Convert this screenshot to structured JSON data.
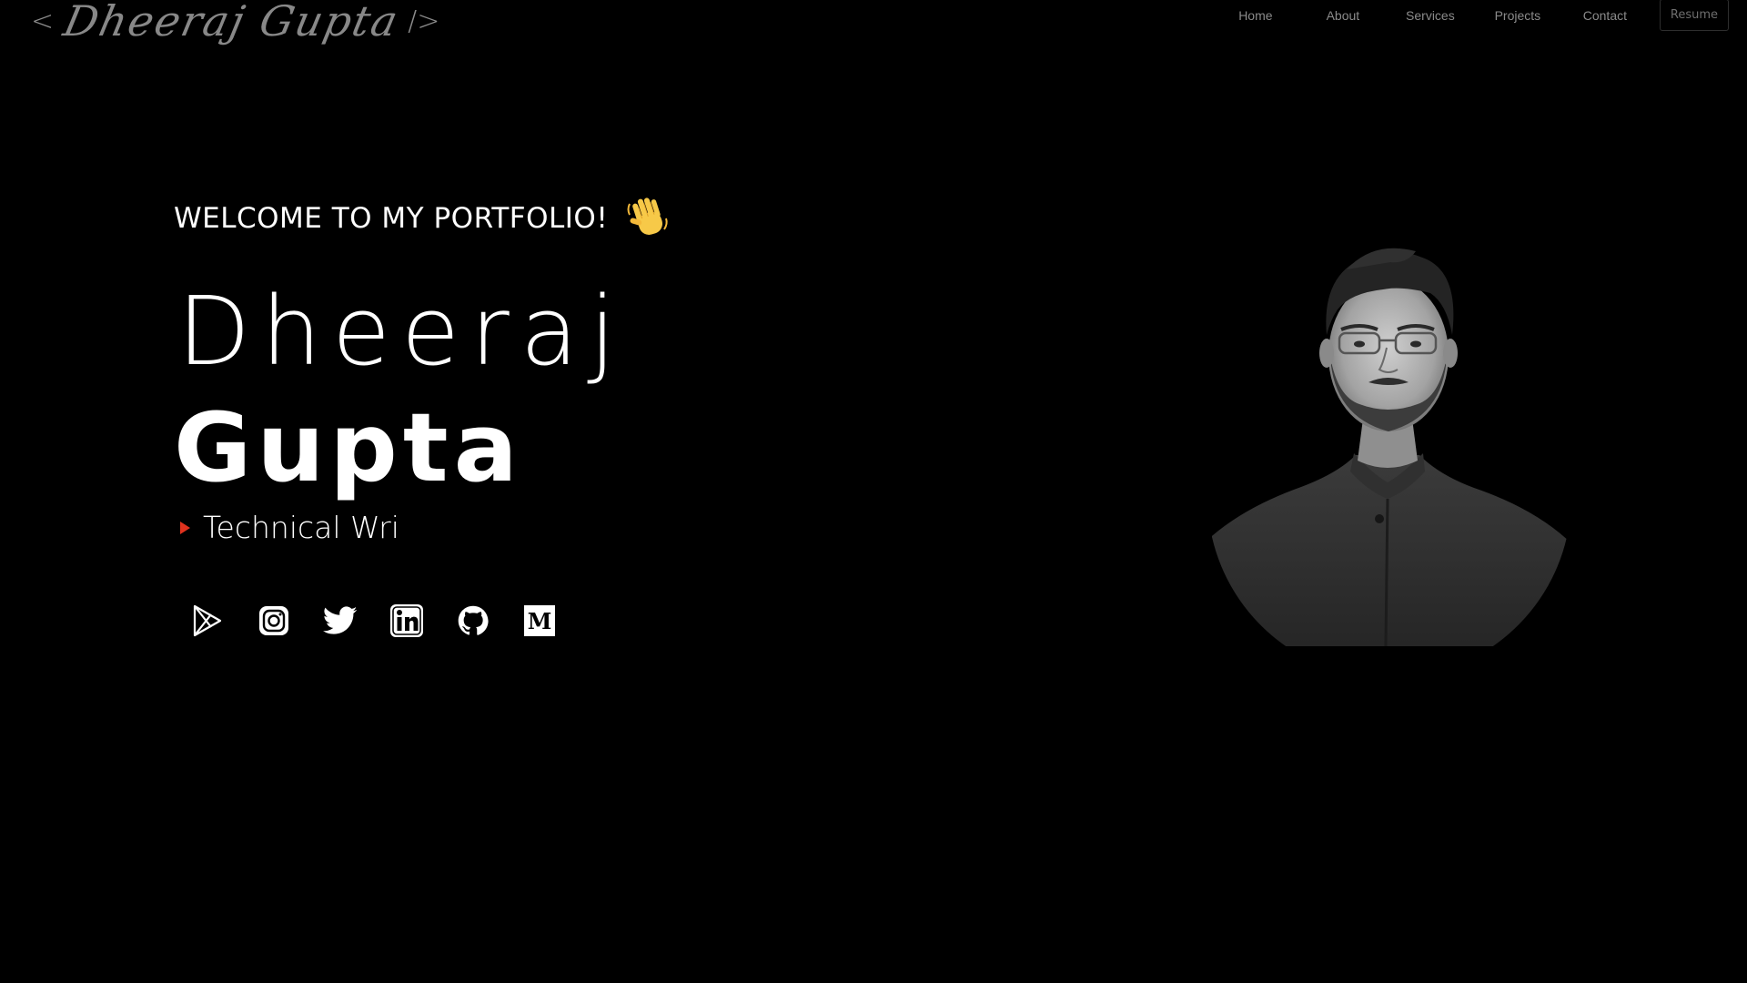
{
  "header": {
    "logo": {
      "open_bracket": "<",
      "signature": "Dheeraj Gupta",
      "close_bracket": "/>"
    },
    "nav": [
      {
        "label": "Home"
      },
      {
        "label": "About"
      },
      {
        "label": "Services"
      },
      {
        "label": "Projects"
      },
      {
        "label": "Contact"
      }
    ],
    "resume_label": "Resume"
  },
  "hero": {
    "welcome": "WELCOME TO MY PORTFOLIO!",
    "wave_icon": "waving-hand-icon",
    "first_name": "Dheeraj",
    "last_name": "Gupta",
    "role_typed": "Technical Wri"
  },
  "socials": [
    {
      "icon": "google-play-icon"
    },
    {
      "icon": "instagram-icon"
    },
    {
      "icon": "twitter-icon"
    },
    {
      "icon": "linkedin-icon"
    },
    {
      "icon": "github-icon"
    },
    {
      "icon": "medium-icon"
    }
  ],
  "colors": {
    "background": "#000000",
    "text": "#ffffff",
    "accent": "#e0321e",
    "nav_text": "#8a8a8a"
  }
}
